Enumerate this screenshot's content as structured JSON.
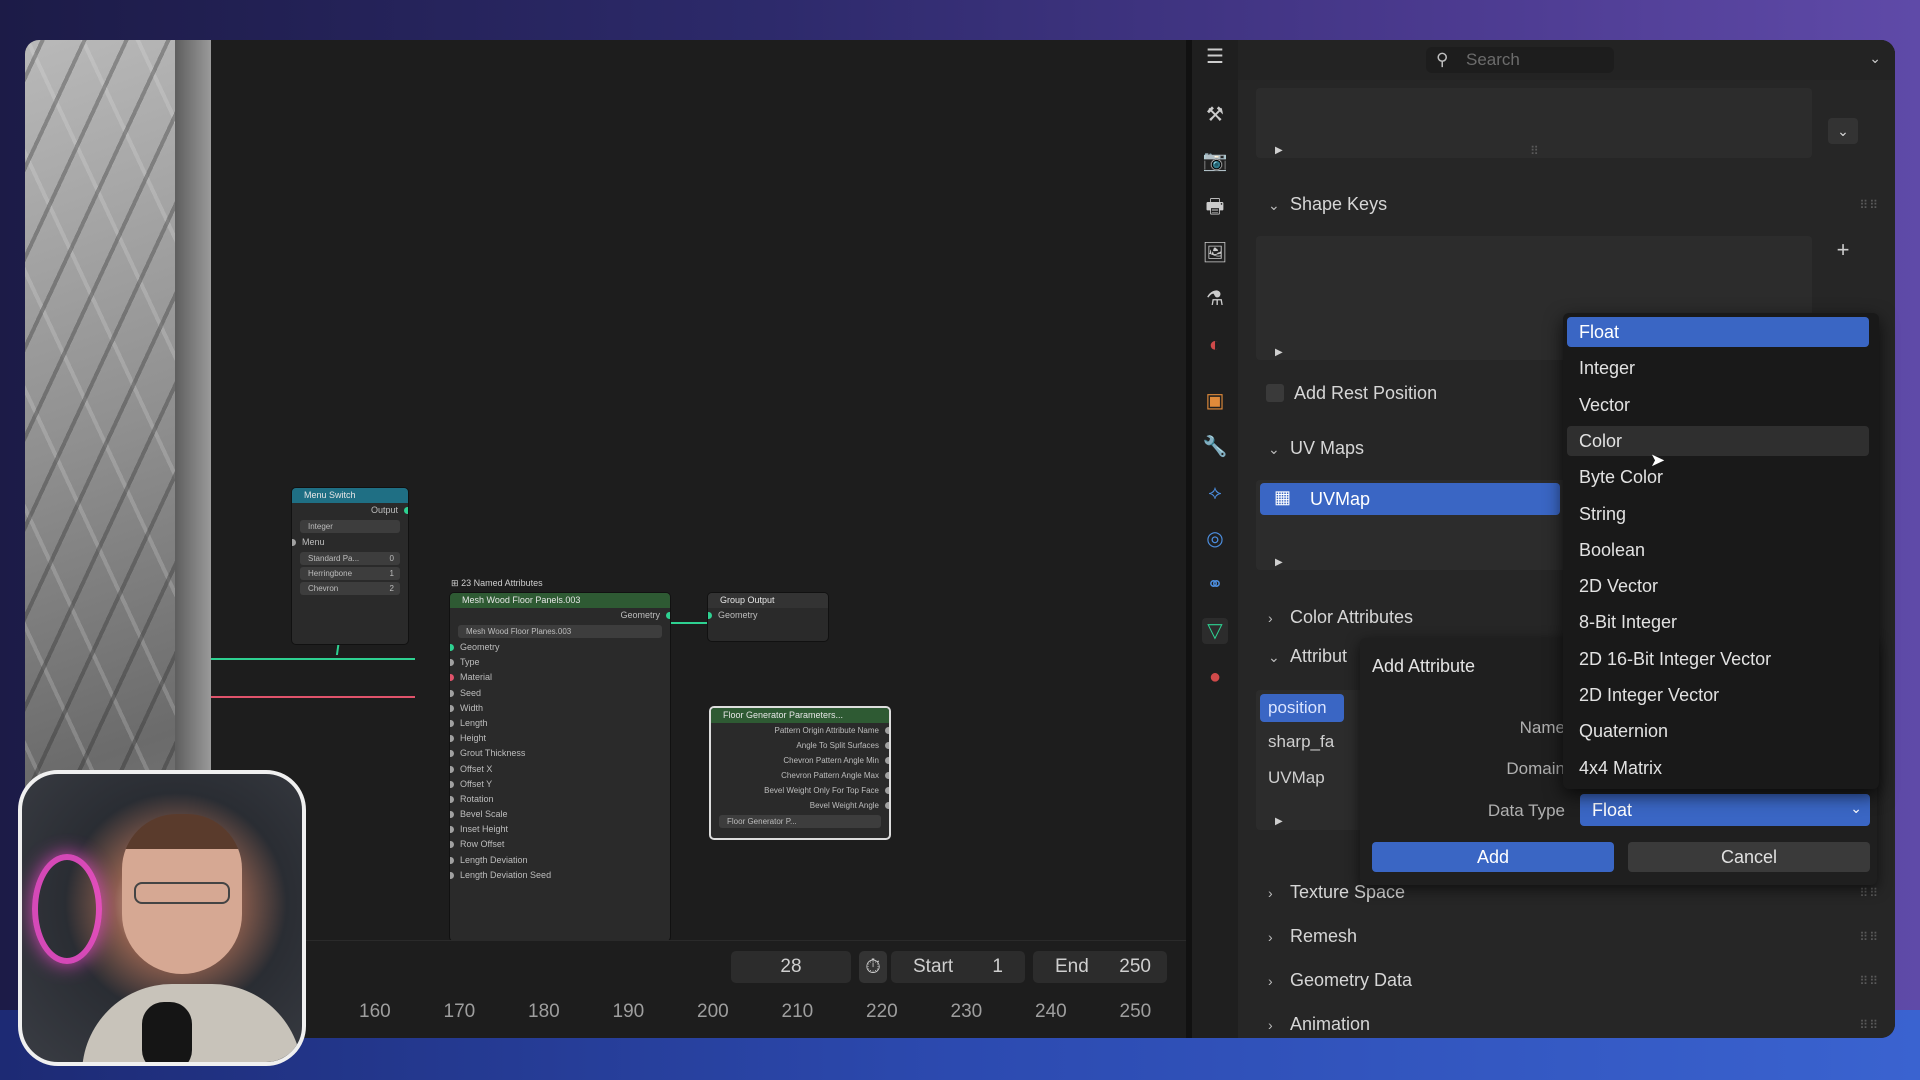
{
  "nodes": {
    "menu_switch": {
      "title": "Menu Switch",
      "output": "Output",
      "type": "Integer",
      "menu": "Menu",
      "items": [
        {
          "label": "Standard Pa...",
          "value": "0"
        },
        {
          "label": "Herringbone",
          "value": "1"
        },
        {
          "label": "Chevron",
          "value": "2"
        }
      ]
    },
    "named_attr": {
      "frame_title": "23 Named Attributes",
      "title": "Mesh Wood Floor Panels.003",
      "geometry_out": "Geometry",
      "group_name": "Mesh Wood Floor Planes.003",
      "inputs": [
        "Geometry",
        "Type",
        "Material",
        "Seed",
        "Width",
        "Length",
        "Height",
        "Grout Thickness",
        "Offset X",
        "Offset Y",
        "Rotation",
        "Bevel Scale",
        "Inset Height",
        "Row Offset",
        "Length Deviation",
        "Length Deviation Seed"
      ]
    },
    "group_output": {
      "title": "Group Output",
      "input": "Geometry"
    },
    "floor_params": {
      "title": "Floor Generator Parameters...",
      "group_name": "Floor Generator P...",
      "outputs": [
        "Pattern Origin Attribute Name",
        "Angle To Split Surfaces",
        "Chevron Pattern Angle Min",
        "Chevron Pattern Angle Max",
        "Bevel Weight Only For Top Face",
        "Bevel Weight Angle"
      ]
    }
  },
  "timeline": {
    "current_frame": "28",
    "start_label": "Start",
    "start_value": "1",
    "end_label": "End",
    "end_value": "250",
    "ticks": [
      "160",
      "170",
      "180",
      "190",
      "200",
      "210",
      "220",
      "230",
      "240",
      "250"
    ]
  },
  "properties": {
    "search_placeholder": "Search",
    "shape_keys": "Shape Keys",
    "add_rest_position": "Add Rest Position",
    "uv_maps": "UV Maps",
    "uv_map_item": "UVMap",
    "color_attributes": "Color Attributes",
    "attributes": "Attribut",
    "attribute_items": [
      "position",
      "sharp_fa",
      "UVMap"
    ],
    "texture_space": "Texture Space",
    "remesh": "Remesh",
    "geometry_data": "Geometry Data",
    "animation": "Animation"
  },
  "popup": {
    "title": "Add Attribute",
    "name_label": "Name",
    "domain_label": "Domain",
    "data_type_label": "Data Type",
    "data_type_value": "Float",
    "add_button": "Add",
    "cancel_button": "Cancel"
  },
  "dropdown": {
    "items": [
      "Float",
      "Integer",
      "Vector",
      "Color",
      "Byte Color",
      "String",
      "Boolean",
      "2D Vector",
      "8-Bit Integer",
      "2D 16-Bit Integer Vector",
      "2D Integer Vector",
      "Quaternion",
      "4x4 Matrix"
    ],
    "selected": "Float",
    "hovered": "Color"
  },
  "colors": {
    "accent": "#3a66c4",
    "socket_green": "#2ed191",
    "socket_gray": "#a1a1a1",
    "socket_red": "#e0536b",
    "node_header_teal": "#1f6f84",
    "node_header_green": "#2e5a33"
  }
}
